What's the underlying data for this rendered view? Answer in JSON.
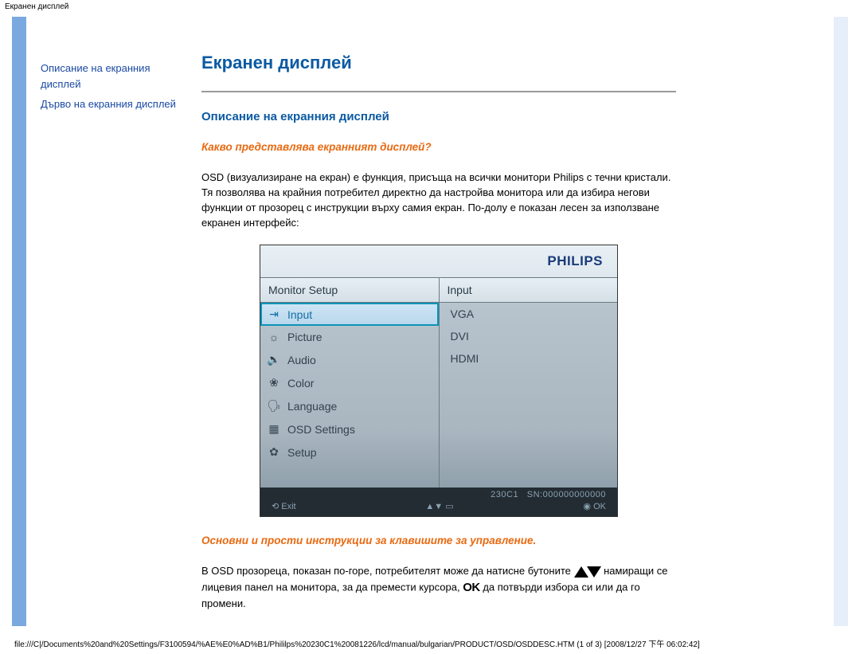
{
  "header_title": "Екранен дисплей",
  "sidebar": {
    "link1": "Описание на екранния дисплей",
    "link2": "Дърво на екранния дисплей"
  },
  "page_title": "Екранен дисплей",
  "section1_title": "Описание на екранния дисплей",
  "question1": "Какво представлява екранният дисплей?",
  "para1": "OSD (визуализиране на екран) е функция, присъща на всички монитори Philips с течни кристали. Тя позволява на крайния потребител директно да настройва монитора или да избира негови функции от прозорец с инструкции върху самия екран. По-долу е показан лесен за използване екранен интерфейс:",
  "osd": {
    "brand": "PHILIPS",
    "left_header": "Monitor Setup",
    "right_header": "Input",
    "left_items": [
      {
        "glyph": "⇥",
        "label": "Input",
        "selected": true
      },
      {
        "glyph": "☼",
        "label": "Picture"
      },
      {
        "glyph": "🔈",
        "label": "Audio"
      },
      {
        "glyph": "❀",
        "label": "Color"
      },
      {
        "glyph": "🗣",
        "label": "Language"
      },
      {
        "glyph": "▦",
        "label": "OSD Settings"
      },
      {
        "glyph": "✿",
        "label": "Setup"
      }
    ],
    "right_items": [
      "VGA",
      "DVI",
      "HDMI"
    ],
    "serial_line_model": "230C1",
    "serial_line_sn": "SN:000000000000",
    "foot_left": "⟲   Exit",
    "foot_mid": "▲▼    ▭",
    "foot_right": "◉   OK"
  },
  "instructions_heading": "Основни и прости инструкции за клавишите за управление.",
  "para2_a": "В OSD прозореца, показан по-горе, потребителят може да натисне бутоните ",
  "para2_b": " намиращи се лицевия панел на монитора, за да премести курсора, ",
  "para2_c": " да потвърди избора си или да го промени.",
  "ok_text": "OK",
  "footer_path": "file:///C|/Documents%20and%20Settings/F3100594/%AE%E0%AD%B1/Phililps%20230C1%20081226/lcd/manual/bulgarian/PRODUCT/OSD/OSDDESC.HTM (1 of 3) [2008/12/27 下午 06:02:42]"
}
